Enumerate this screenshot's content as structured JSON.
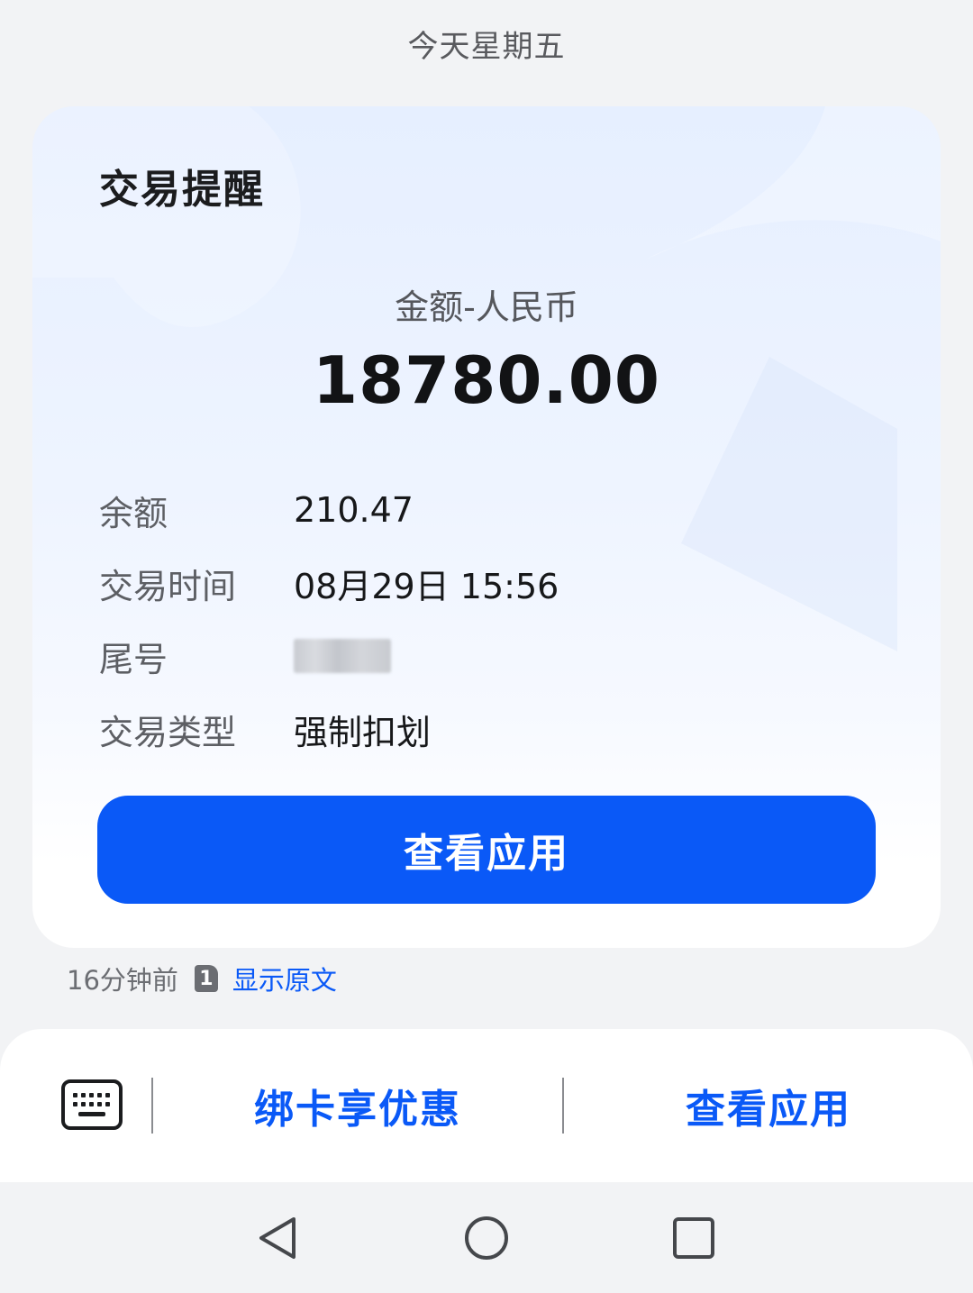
{
  "header": {
    "date_text": "今天星期五"
  },
  "card": {
    "title": "交易提醒",
    "amount_label": "金额-人民币",
    "amount_value": "18780.00",
    "details": [
      {
        "label": "余额",
        "value": "210.47"
      },
      {
        "label": "交易时间",
        "value": "08月29日 15:56"
      },
      {
        "label": "尾号",
        "value": ""
      },
      {
        "label": "交易类型",
        "value": "强制扣划"
      }
    ],
    "button_label": "查看应用"
  },
  "meta": {
    "time_ago": "16分钟前",
    "sim_slot": "1",
    "show_original": "显示原文"
  },
  "bottom_bar": {
    "keyboard_icon": "keyboard-icon",
    "actions": [
      {
        "label": "绑卡享优惠"
      },
      {
        "label": "查看应用"
      }
    ]
  },
  "nav_bar": {
    "icons": [
      "back-triangle-icon",
      "home-circle-icon",
      "recents-square-icon"
    ]
  },
  "colors": {
    "accent": "#0a59f7",
    "background": "#f2f3f5"
  }
}
